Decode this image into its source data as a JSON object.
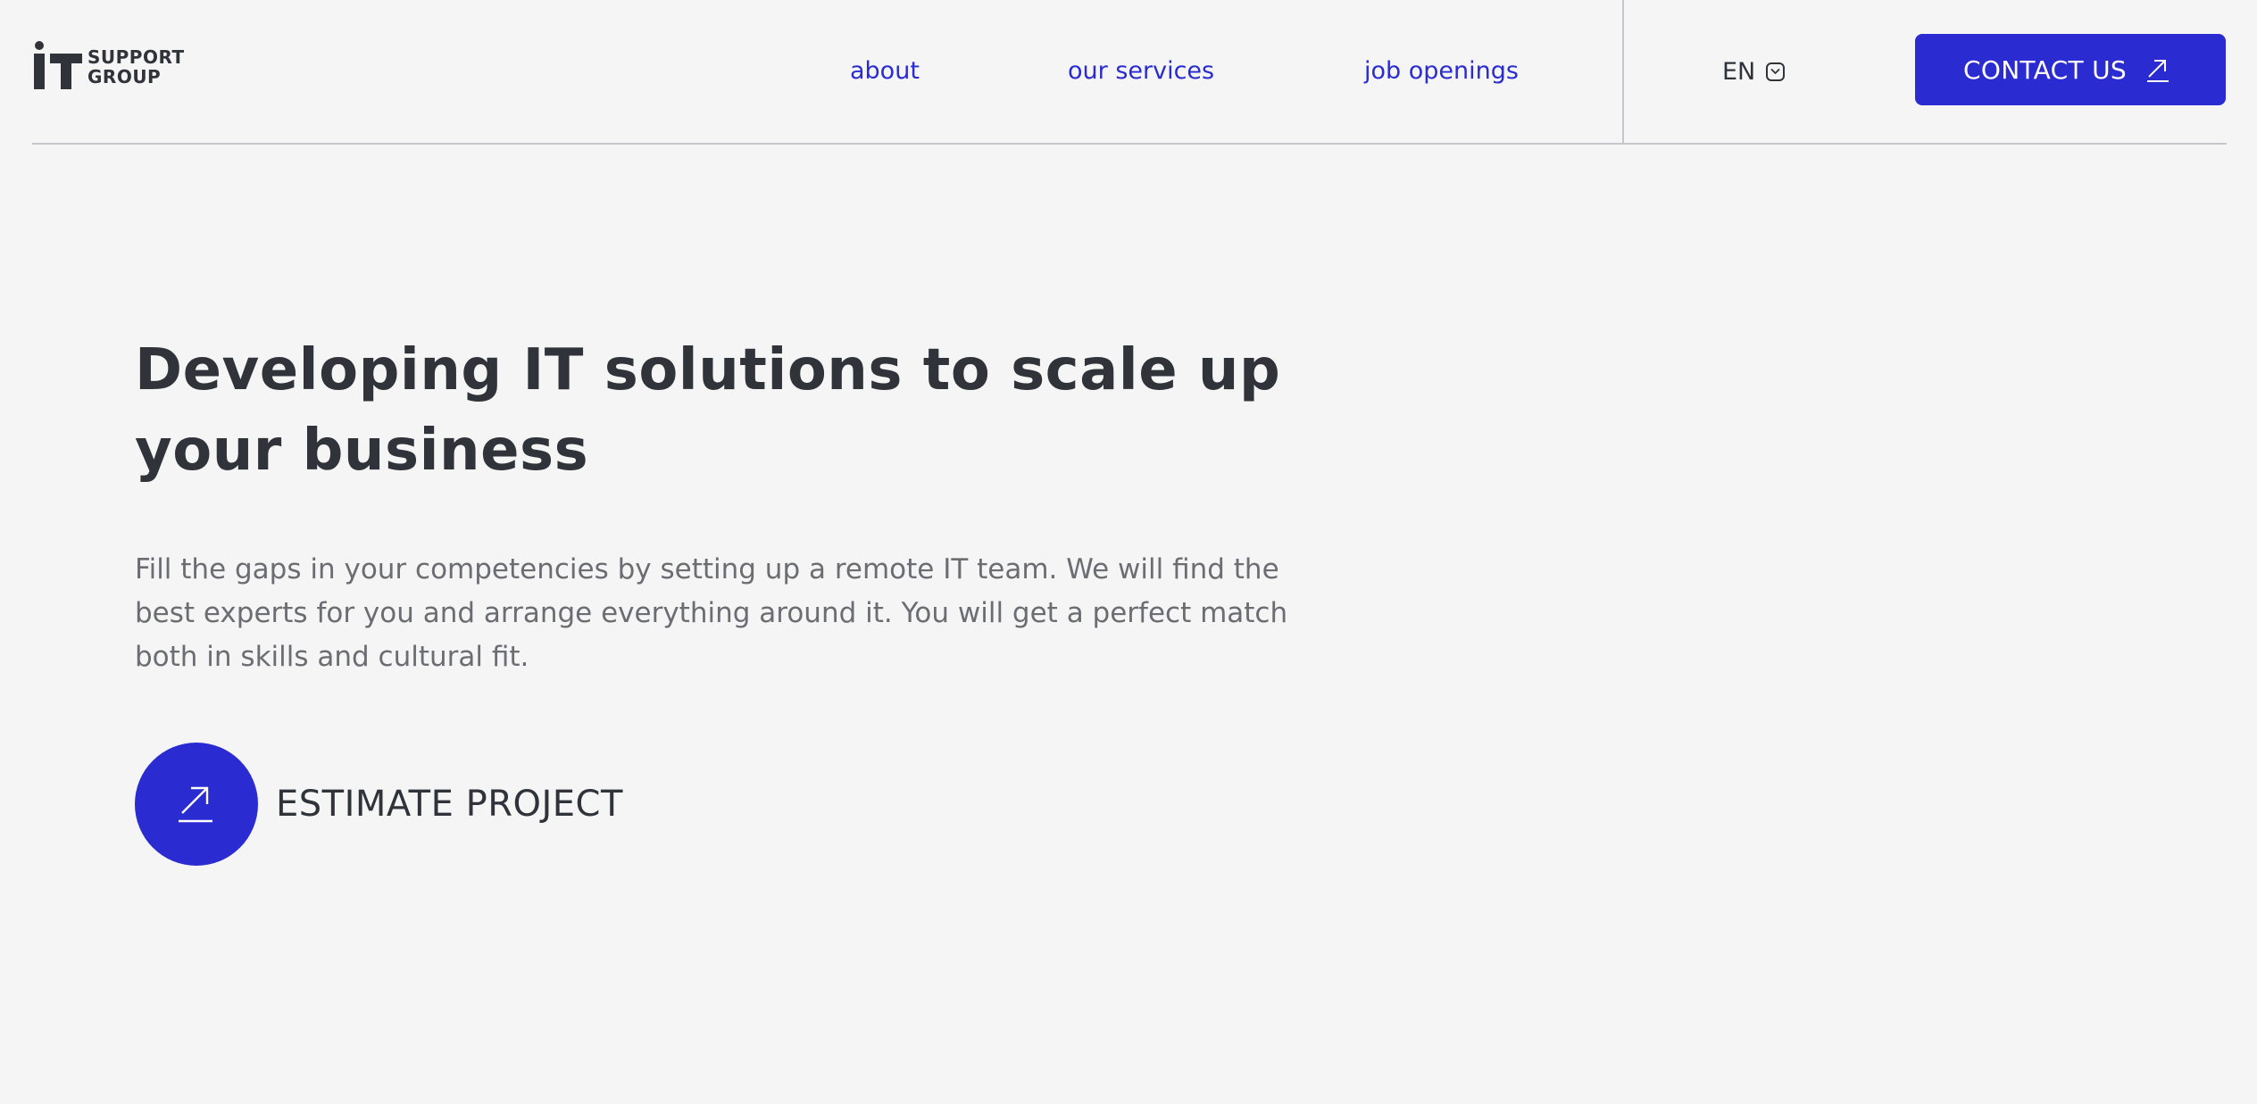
{
  "header": {
    "logo": {
      "mark": "iT",
      "line1": "SUPPORT",
      "line2": "GROUP"
    },
    "nav": [
      {
        "label": "about"
      },
      {
        "label": "our services"
      },
      {
        "label": "job openings"
      }
    ],
    "language": {
      "label": "EN",
      "icon": "chevron-down-icon"
    },
    "contact_button": {
      "label": "CONTACT US",
      "icon": "arrow-up-right-icon"
    }
  },
  "hero": {
    "title": "Developing IT solutions to scale up your business",
    "description": "Fill the gaps in your competencies by setting up a remote IT team. We will find the best experts for you and arrange everything around it. You will get a perfect match both in skills and cultural fit.",
    "cta": {
      "label": "ESTIMATE PROJECT",
      "icon": "arrow-up-right-icon"
    }
  },
  "colors": {
    "accent": "#2a2bd0",
    "text": "#30333a",
    "muted": "#6c6d72",
    "background": "#f5f5f5",
    "divider": "#c6c7cc"
  }
}
